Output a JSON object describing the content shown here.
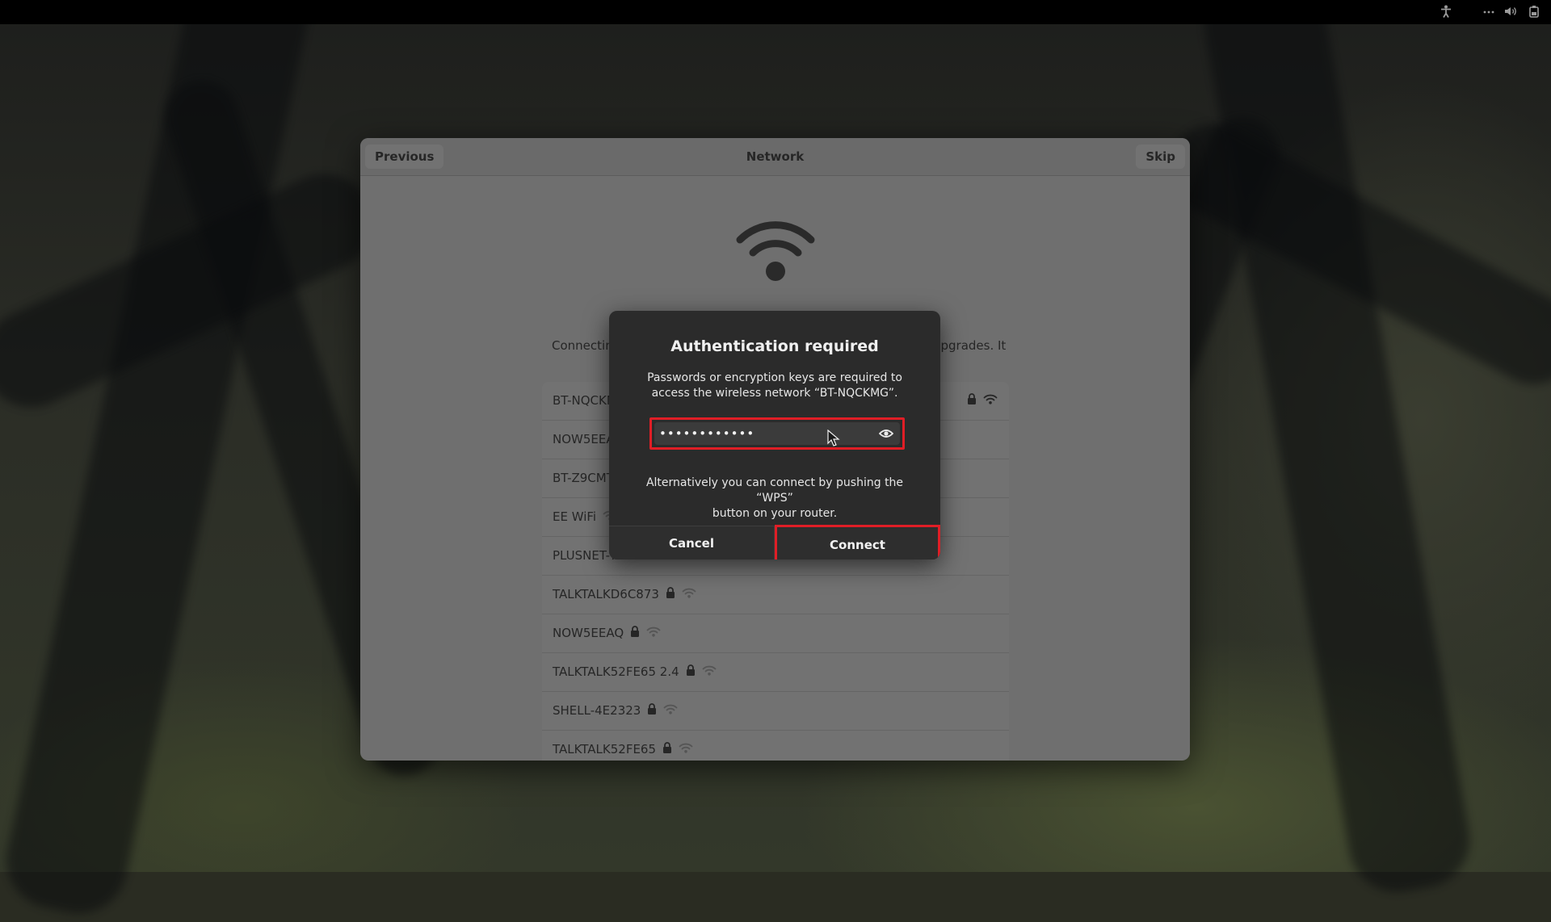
{
  "window": {
    "previous_label": "Previous",
    "title": "Network",
    "skip_label": "Skip",
    "intro_left": "Connecting",
    "intro_right": "upgrades. It"
  },
  "networks": [
    {
      "name": "BT-NQCKMG",
      "visible_name": "BT-NQCKN",
      "locked": true,
      "signal_icon": "wifi-strong-icon"
    },
    {
      "name": "NOW5EEA",
      "visible_name": "NOW5EEA",
      "locked": true,
      "signal_icon": "wifi-icon"
    },
    {
      "name": "BT-Z9CMT",
      "visible_name": "BT-Z9CMT",
      "locked": true,
      "signal_icon": "wifi-icon"
    },
    {
      "name": "EE WiFi",
      "visible_name": "EE WiFi",
      "locked": false,
      "signal_icon": "wifi-icon"
    },
    {
      "name": "PLUSNET-7",
      "visible_name": "PLUSNET-7",
      "locked": true,
      "signal_icon": "wifi-icon"
    },
    {
      "name": "TALKTALKD6C873",
      "visible_name": "TALKTALKD6C873",
      "locked": true,
      "signal_icon": "wifi-icon"
    },
    {
      "name": "NOW5EEAQ",
      "visible_name": "NOW5EEAQ",
      "locked": true,
      "signal_icon": "wifi-icon"
    },
    {
      "name": "TALKTALK52FE65 2.4",
      "visible_name": "TALKTALK52FE65 2.4",
      "locked": true,
      "signal_icon": "wifi-icon"
    },
    {
      "name": "SHELL-4E2323",
      "visible_name": "SHELL-4E2323",
      "locked": true,
      "signal_icon": "wifi-icon"
    },
    {
      "name": "TALKTALK52FE65",
      "visible_name": "TALKTALK52FE65",
      "locked": true,
      "signal_icon": "wifi-icon"
    }
  ],
  "dialog": {
    "title": "Authentication required",
    "message_line1": "Passwords or encryption keys are required to",
    "message_line2": "access the wireless network “BT-NQCKMG”.",
    "password_value": "••••••••••••",
    "alt_line1": "Alternatively you can connect by pushing the “WPS”",
    "alt_line2": "button on your router.",
    "cancel_label": "Cancel",
    "connect_label": "Connect",
    "highlight_color": "#e01e26"
  },
  "topbar_icons": [
    "accessibility-icon",
    "network-icon",
    "volume-icon",
    "power-icon"
  ]
}
